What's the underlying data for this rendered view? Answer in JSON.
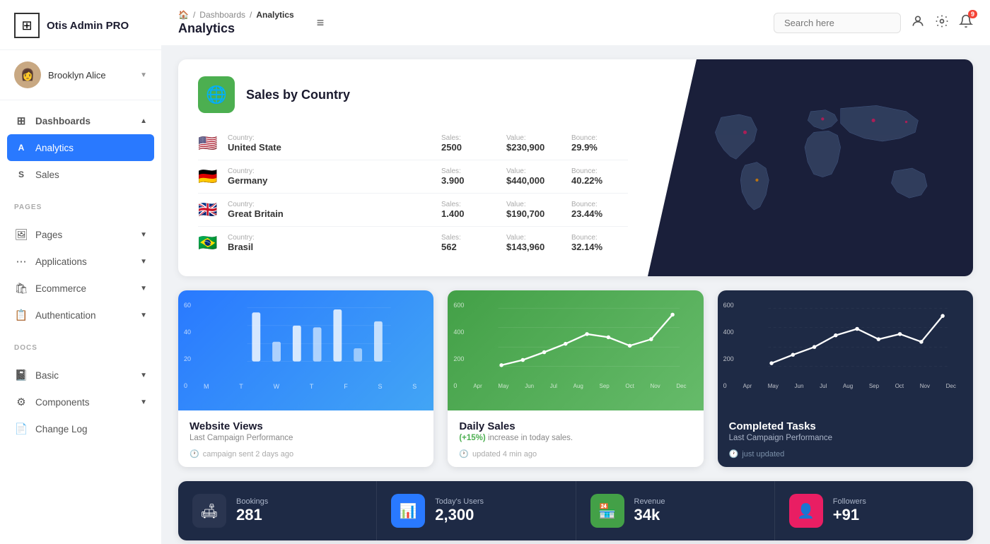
{
  "app": {
    "name": "Otis Admin PRO"
  },
  "user": {
    "name": "Brooklyn Alice",
    "avatar_emoji": "👩"
  },
  "sidebar": {
    "sections": [
      {
        "items": [
          {
            "id": "dashboards",
            "label": "Dashboards",
            "icon": "⊞",
            "type": "parent",
            "active": false,
            "chevron": "▲"
          },
          {
            "id": "analytics",
            "label": "Analytics",
            "letter": "A",
            "type": "child",
            "active": true
          },
          {
            "id": "sales",
            "label": "Sales",
            "letter": "S",
            "type": "child",
            "active": false
          }
        ]
      },
      {
        "label": "PAGES",
        "items": [
          {
            "id": "pages",
            "label": "Pages",
            "icon": "🖼",
            "chevron": "▼"
          },
          {
            "id": "applications",
            "label": "Applications",
            "icon": "⋯",
            "chevron": "▼"
          },
          {
            "id": "ecommerce",
            "label": "Ecommerce",
            "icon": "🛍",
            "chevron": "▼"
          },
          {
            "id": "authentication",
            "label": "Authentication",
            "icon": "📋",
            "chevron": "▼"
          }
        ]
      },
      {
        "label": "DOCS",
        "items": [
          {
            "id": "basic",
            "label": "Basic",
            "icon": "📓",
            "chevron": "▼"
          },
          {
            "id": "components",
            "label": "Components",
            "icon": "⚙",
            "chevron": "▼"
          },
          {
            "id": "changelog",
            "label": "Change Log",
            "icon": "📄"
          }
        ]
      }
    ]
  },
  "header": {
    "breadcrumb": [
      "🏠",
      "/",
      "Dashboards",
      "/",
      "Analytics"
    ],
    "title": "Analytics",
    "hamburger": "≡",
    "search_placeholder": "Search here",
    "notification_count": "9"
  },
  "sales_by_country": {
    "title": "Sales by Country",
    "icon": "🌐",
    "rows": [
      {
        "flag": "🇺🇸",
        "country_label": "Country:",
        "country": "United State",
        "sales_label": "Sales:",
        "sales": "2500",
        "value_label": "Value:",
        "value": "$230,900",
        "bounce_label": "Bounce:",
        "bounce": "29.9%"
      },
      {
        "flag": "🇩🇪",
        "country_label": "Country:",
        "country": "Germany",
        "sales_label": "Sales:",
        "sales": "3.900",
        "value_label": "Value:",
        "value": "$440,000",
        "bounce_label": "Bounce:",
        "bounce": "40.22%"
      },
      {
        "flag": "🇬🇧",
        "country_label": "Country:",
        "country": "Great Britain",
        "sales_label": "Sales:",
        "sales": "1.400",
        "value_label": "Value:",
        "value": "$190,700",
        "bounce_label": "Bounce:",
        "bounce": "23.44%"
      },
      {
        "flag": "🇧🇷",
        "country_label": "Country:",
        "country": "Brasil",
        "sales_label": "Sales:",
        "sales": "562",
        "value_label": "Value:",
        "value": "$143,960",
        "bounce_label": "Bounce:",
        "bounce": "32.14%"
      }
    ]
  },
  "charts": {
    "website_views": {
      "title": "Website Views",
      "subtitle": "Last Campaign Performance",
      "time": "campaign sent 2 days ago",
      "y_labels": [
        "60",
        "40",
        "20",
        "0"
      ],
      "x_labels": [
        "M",
        "T",
        "W",
        "T",
        "F",
        "S",
        "S"
      ],
      "bars": [
        55,
        20,
        40,
        38,
        58,
        15,
        45
      ]
    },
    "daily_sales": {
      "title": "Daily Sales",
      "subtitle": "(+15%) increase in today sales.",
      "highlight": "+15%",
      "time": "updated 4 min ago",
      "y_labels": [
        "600",
        "400",
        "200",
        "0"
      ],
      "x_labels": [
        "Apr",
        "May",
        "Jun",
        "Jul",
        "Aug",
        "Sep",
        "Oct",
        "Nov",
        "Dec"
      ],
      "values": [
        20,
        80,
        180,
        280,
        380,
        320,
        200,
        300,
        480
      ]
    },
    "completed_tasks": {
      "title": "Completed Tasks",
      "subtitle": "Last Campaign Performance",
      "time": "just updated",
      "y_labels": [
        "600",
        "400",
        "200",
        "0"
      ],
      "x_labels": [
        "Apr",
        "May",
        "Jun",
        "Jul",
        "Aug",
        "Sep",
        "Oct",
        "Nov",
        "Dec"
      ],
      "values": [
        30,
        120,
        220,
        350,
        420,
        300,
        350,
        280,
        460
      ]
    }
  },
  "bottom_stats": [
    {
      "id": "bookings",
      "icon": "🛋",
      "icon_class": "icon-dark",
      "label": "Bookings",
      "value": "281"
    },
    {
      "id": "today_users",
      "icon": "📊",
      "icon_class": "icon-blue",
      "label": "Today's Users",
      "value": "2,300"
    },
    {
      "id": "revenue",
      "icon": "🏪",
      "icon_class": "icon-green",
      "label": "Revenue",
      "value": "34k"
    },
    {
      "id": "followers",
      "icon": "👤",
      "icon_class": "icon-pink",
      "label": "Followers",
      "value": "+91"
    }
  ]
}
